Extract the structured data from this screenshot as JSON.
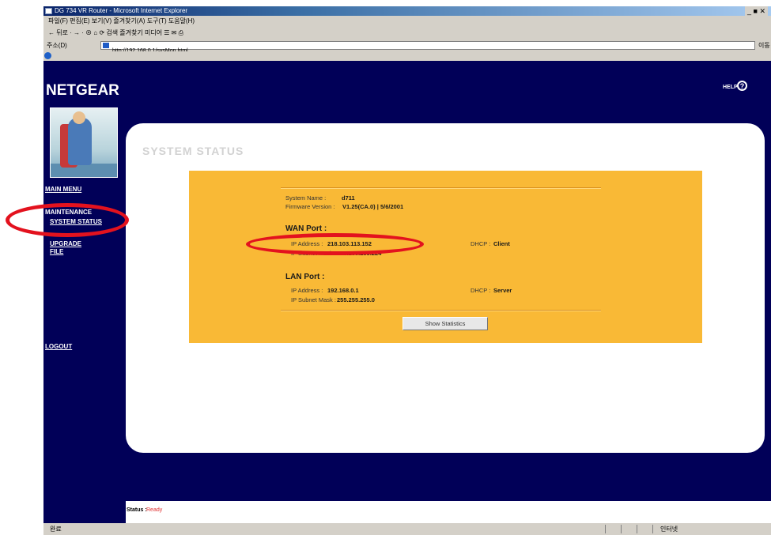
{
  "window": {
    "title": "DG 734 VR Router - Microsoft Internet Explorer",
    "controls": "_ ■ ✕"
  },
  "menubar": {
    "text": "파일(F)  편집(E)  보기(V)  즐겨찾기(A)  도구(T)  도움말(H)"
  },
  "toolbar": {
    "text": "← 뒤로 · → · ⊗ ⌂ ⟳  검색  즐겨찾기  미디어  ☰ ✉ ⎙"
  },
  "addressbar": {
    "label": "주소(D)",
    "url": "http://192.168.0.1/sysMon.html",
    "go": "이동"
  },
  "page": {
    "logo": "NETGEAR",
    "help": "HELP",
    "help_icon": "?",
    "nav": {
      "main_menu": "MAIN MENU",
      "maintenance": "MAINTENANCE",
      "system_status": "SYSTEM STATUS",
      "upgrade": "UPGRADE",
      "file": "FILE",
      "logout": "LOGOUT"
    },
    "title": "SYSTEM STATUS",
    "system": {
      "name_label": "System Name :",
      "name_value": "d711",
      "firmware_label": "Firmware Version :",
      "firmware_value": "V1.25(CA.0) | 5/6/2001"
    },
    "wan": {
      "heading": "WAN Port :",
      "ip_label": "IP Address :",
      "ip_value": "218.103.113.152",
      "mask_label": "IP Subnet Mask :",
      "mask_value": "255.255.255.224",
      "dhcp_label": "DHCP :",
      "dhcp_value": "Client"
    },
    "lan": {
      "heading": "LAN Port :",
      "ip_label": "IP Address :",
      "ip_value": "192.168.0.1",
      "mask_label": "IP Subnet Mask :",
      "mask_value": "255.255.255.0",
      "dhcp_label": "DHCP :",
      "dhcp_value": "Server"
    },
    "stats_button": "Show Statistics",
    "status_label": "Status :",
    "status_value": "Ready"
  },
  "ie_status": {
    "left": "완료",
    "right": "인터넷"
  },
  "colors": {
    "nav_bg": "#010058",
    "panel": "#f9b936",
    "annotation": "#e3121e"
  }
}
